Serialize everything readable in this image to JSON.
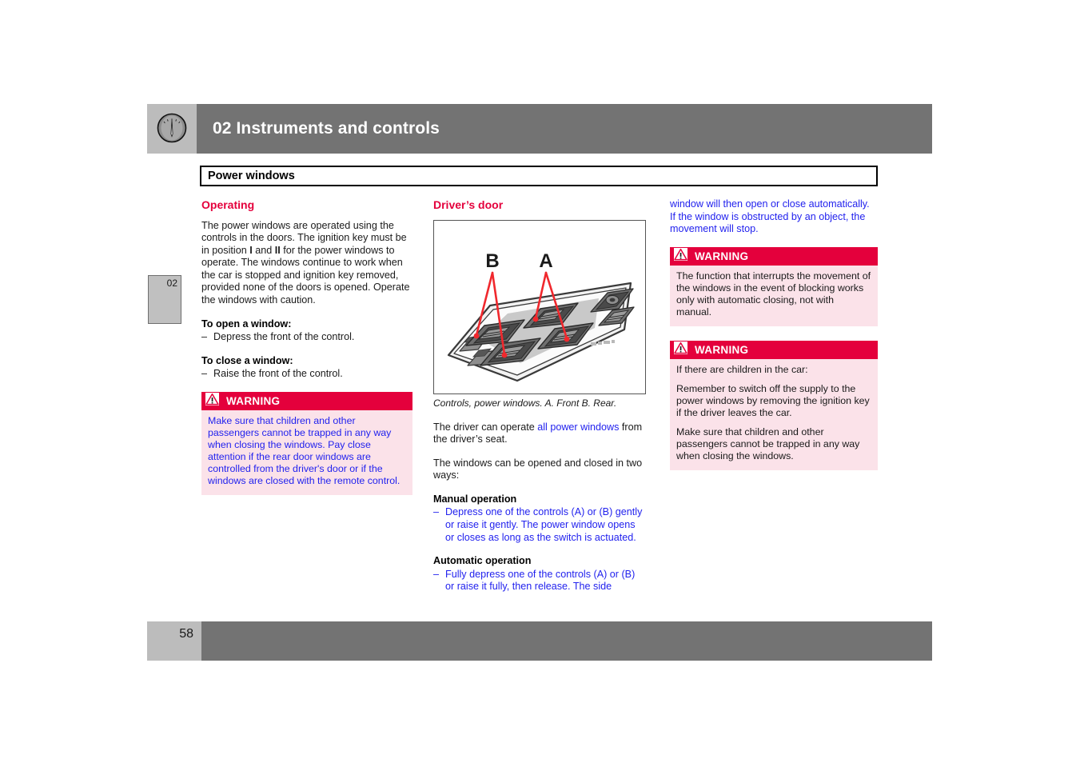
{
  "header": {
    "chapter_title": "02 Instruments and controls",
    "icon": "gauge-icon"
  },
  "section": {
    "title": "Power windows"
  },
  "side_tab": {
    "chapter_number": "02"
  },
  "footer": {
    "page_number": "58"
  },
  "colors": {
    "accent_red": "#e4003c",
    "warning_bg": "#fbe2e9",
    "link_blue": "#2222ee",
    "header_gray": "#737373",
    "tab_gray": "#bcbcbc"
  },
  "left_column": {
    "heading": "Operating",
    "paragraph_1_a": "The power windows are operated using the controls in the doors. The ignition key must be in position ",
    "paragraph_1_b": "I",
    "paragraph_1_c": " and ",
    "paragraph_1_d": "II",
    "paragraph_1_e": " for the power windows to operate. The windows continue to work when the car is stopped and ignition key removed, provided none of the doors is opened. Operate the windows with caution.",
    "open_heading": "To open a window:",
    "open_item": "Depress the front of the control.",
    "close_heading": "To close a window:",
    "close_item": "Raise the front of the control.",
    "warning": {
      "label": "WARNING",
      "icon": "warning-triangle-icon",
      "body": "Make sure that children and other passengers cannot be trapped in any way when closing the windows. Pay close attention if the rear door windows are controlled from the driver's door or if the windows are closed with the remote control."
    }
  },
  "middle_column": {
    "heading": "Driver’s door",
    "figure": {
      "name": "power-window-controls-illustration",
      "label_a": "A",
      "label_b": "B",
      "caption": "Controls, power windows. A. Front B. Rear."
    },
    "paragraph_1_a": "The driver can operate ",
    "paragraph_1_link": "all power windows",
    "paragraph_1_b": " from the driver’s seat.",
    "paragraph_2": "The windows can be opened and closed in two ways:",
    "manual_heading": "Manual operation",
    "manual_item": "Depress one of the controls (A) or (B) gently or raise it gently. The power window opens or closes as long as the switch is actuated.",
    "automatic_heading": "Automatic operation",
    "automatic_item": "Fully depress one of the controls (A) or (B) or raise it fully, then release. The side"
  },
  "right_column": {
    "continuation": "window will then open or close automatically. If the window is obstructed by an object, the movement will stop.",
    "warning_1": {
      "label": "WARNING",
      "icon": "warning-triangle-icon",
      "body": "The function that interrupts the movement of the windows in the event of blocking works only with automatic closing, not with manual."
    },
    "warning_2": {
      "label": "WARNING",
      "icon": "warning-triangle-icon",
      "body_1": "If there are children in the car:",
      "body_2": "Remember to switch off the supply to the power windows by removing the ignition key if the driver leaves the car.",
      "body_3": "Make sure that children and other passengers cannot be trapped in any way when closing the windows."
    }
  }
}
